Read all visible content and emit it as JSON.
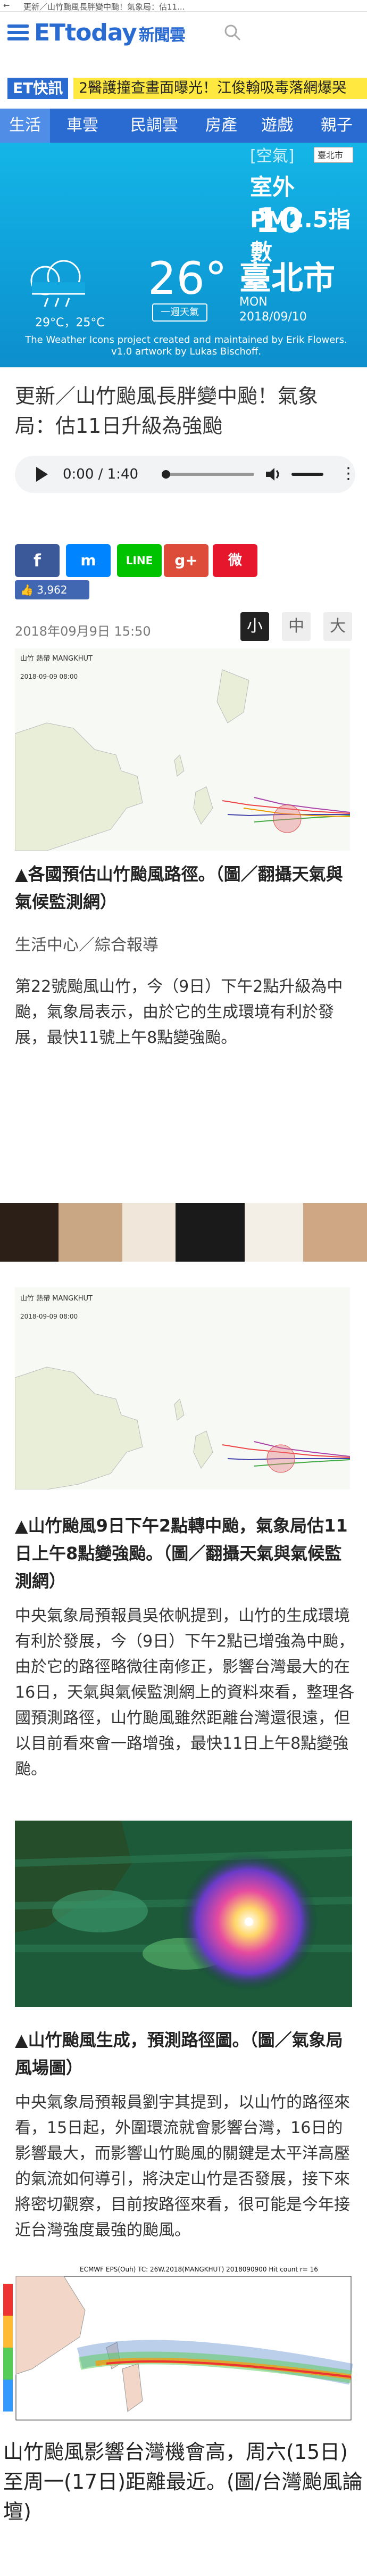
{
  "topbar": {
    "back": "←",
    "title": "更新／山竹颱風長胖變中颱！氣象局：估11..."
  },
  "header": {
    "logo": "ETtoday",
    "logo_sub": "新聞雲"
  },
  "breaking": {
    "badge": "ET快訊",
    "text": "2醫護撞查畫面曝光！江俊翰吸毒落網爆哭"
  },
  "nav": {
    "items": [
      "生活",
      "車雲",
      "民調雲",
      "房產",
      "遊戲",
      "親子"
    ]
  },
  "weather": {
    "pm_header": "[空氣]",
    "select": "臺北市",
    "pm_label": "室外PM2.5指數",
    "pm_value": "10",
    "temp_range": "29°C，25°C",
    "temperature": "26°",
    "week_btn": "一週天氣",
    "city": "臺北市",
    "day": "MON",
    "date": "2018/09/10",
    "credit": "The Weather Icons project created and maintained by Erik Flowers. v1.0 artwork by Lukas Bischoff."
  },
  "article": {
    "headline": "更新／山竹颱風長胖變中颱！氣象局：估11日升級為強颱",
    "audio": {
      "time": "0:00 / 1:40"
    },
    "share": {
      "fb": "f",
      "messenger": "m",
      "line": "LINE",
      "gplus": "g+",
      "weibo": "微"
    },
    "likes": "3,962",
    "pubdate": "2018年09月9日 15:50",
    "font_sizes": [
      "小",
      "中",
      "大"
    ],
    "map1_title": "山竹 熱帶 MANGKHUT",
    "map1_time": "2018-09-09 08:00",
    "caption1": "▲各國預估山竹颱風路徑。（圖／翻攝天氣與氣候監測網）",
    "source": "生活中心／綜合報導",
    "para1": "第22號颱風山竹，今（9日）下午2點升級為中颱，氣象局表示，由於它的生成環境有利於發展，最快11號上午8點變強颱。",
    "map2_title": "山竹 熱帶 MANGKHUT",
    "map2_time": "2018-09-09 08:00",
    "caption2": "▲山竹颱風9日下午2點轉中颱，氣象局估11日上午8點變強颱。（圖／翻攝天氣與氣候監測網）",
    "para2": "中央氣象局預報員吳依帆提到，山竹的生成環境有利於發展，今（9日）下午2點已增強為中颱，由於它的路徑略微往南修正，影響台灣最大的在16日，天氣與氣候監測網上的資料來看，整理各國預測路徑，山竹颱風雖然距離台灣還很遠，但以目前看來會一路增強，最快11日上午8點變強颱。",
    "caption3": "▲山竹颱風生成，預測路徑圖。（圖／氣象局風場圖）",
    "para3": "中央氣象局預報員劉宇其提到，以山竹的路徑來看，15日起，外圍環流就會影響台灣，16日的影響最大，而影響山竹颱風的關鍵是太平洋高壓的氣流如何導引，將決定山竹是否發展，接下來將密切觀察，目前按路徑來看，很可能是今年接近台灣強度最強的颱風。",
    "ecmwf_title": "ECMWF EPS(Ouh) TC: 26W.2018(MANGKHUT)  2018090900 Hit count  r= 16",
    "final": "山竹颱風影響台灣機會高，周六(15日)至周一(17日)距離最近。(圖/台灣颱風論壇)"
  },
  "colors": {
    "brand": "#2a6bd1",
    "breaking_bg": "#ffe840",
    "weather_bg": "#14b6e7"
  }
}
